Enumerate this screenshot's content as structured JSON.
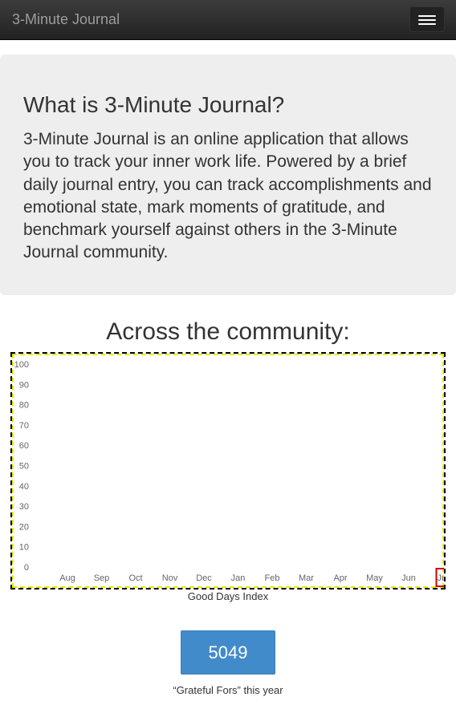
{
  "navbar": {
    "brand": "3-Minute Journal",
    "toggle_icon": "hamburger-icon"
  },
  "jumbotron": {
    "title": "What is 3-Minute Journal?",
    "text": "3-Minute Journal is an online application that allows you to track your inner work life. Powered by a brief daily journal entry, you can track accomplishments and emotional state, mark moments of gratitude, and benchmark yourself against others in the 3-Minute Journal community."
  },
  "community": {
    "title": "Across the community:",
    "chart_caption": "Good Days Index",
    "grateful_count": "5049",
    "grateful_caption": "“Grateful Fors” this year"
  },
  "chart_data": {
    "type": "bar",
    "categories": [
      "Aug",
      "Sep",
      "Oct",
      "Nov",
      "Dec",
      "Jan",
      "Feb",
      "Mar",
      "Apr",
      "May",
      "Jun",
      "Jul"
    ],
    "category_labels": [
      "Aug",
      "Sep",
      "Oct",
      "Nov",
      "Dec",
      "Jan",
      "Feb",
      "Mar",
      "Apr",
      "May",
      "Jun",
      "Jul"
    ],
    "values": [
      0,
      0,
      0,
      0,
      0,
      0,
      0,
      0,
      0,
      0,
      0,
      0
    ],
    "ylim": [
      0,
      100
    ],
    "yticks": [
      0,
      10,
      20,
      30,
      40,
      50,
      60,
      70,
      80,
      90,
      100
    ],
    "highlight_category": "Jul",
    "colors": {
      "highlight": "#cc0000",
      "border_dash": "#e8e800"
    }
  }
}
